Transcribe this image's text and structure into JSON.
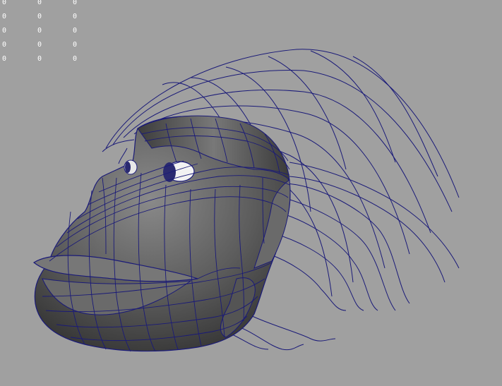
{
  "viewport": {
    "background": "#a0a0a0",
    "wire_color": "#1a1a78",
    "mesh_fill": "#5e5e5e"
  },
  "hud": {
    "rows": [
      [
        "0",
        "0",
        "0"
      ],
      [
        "0",
        "0",
        "0"
      ],
      [
        "0",
        "0",
        "0"
      ],
      [
        "0",
        "0",
        "0"
      ],
      [
        "0",
        "0",
        "0"
      ]
    ]
  }
}
